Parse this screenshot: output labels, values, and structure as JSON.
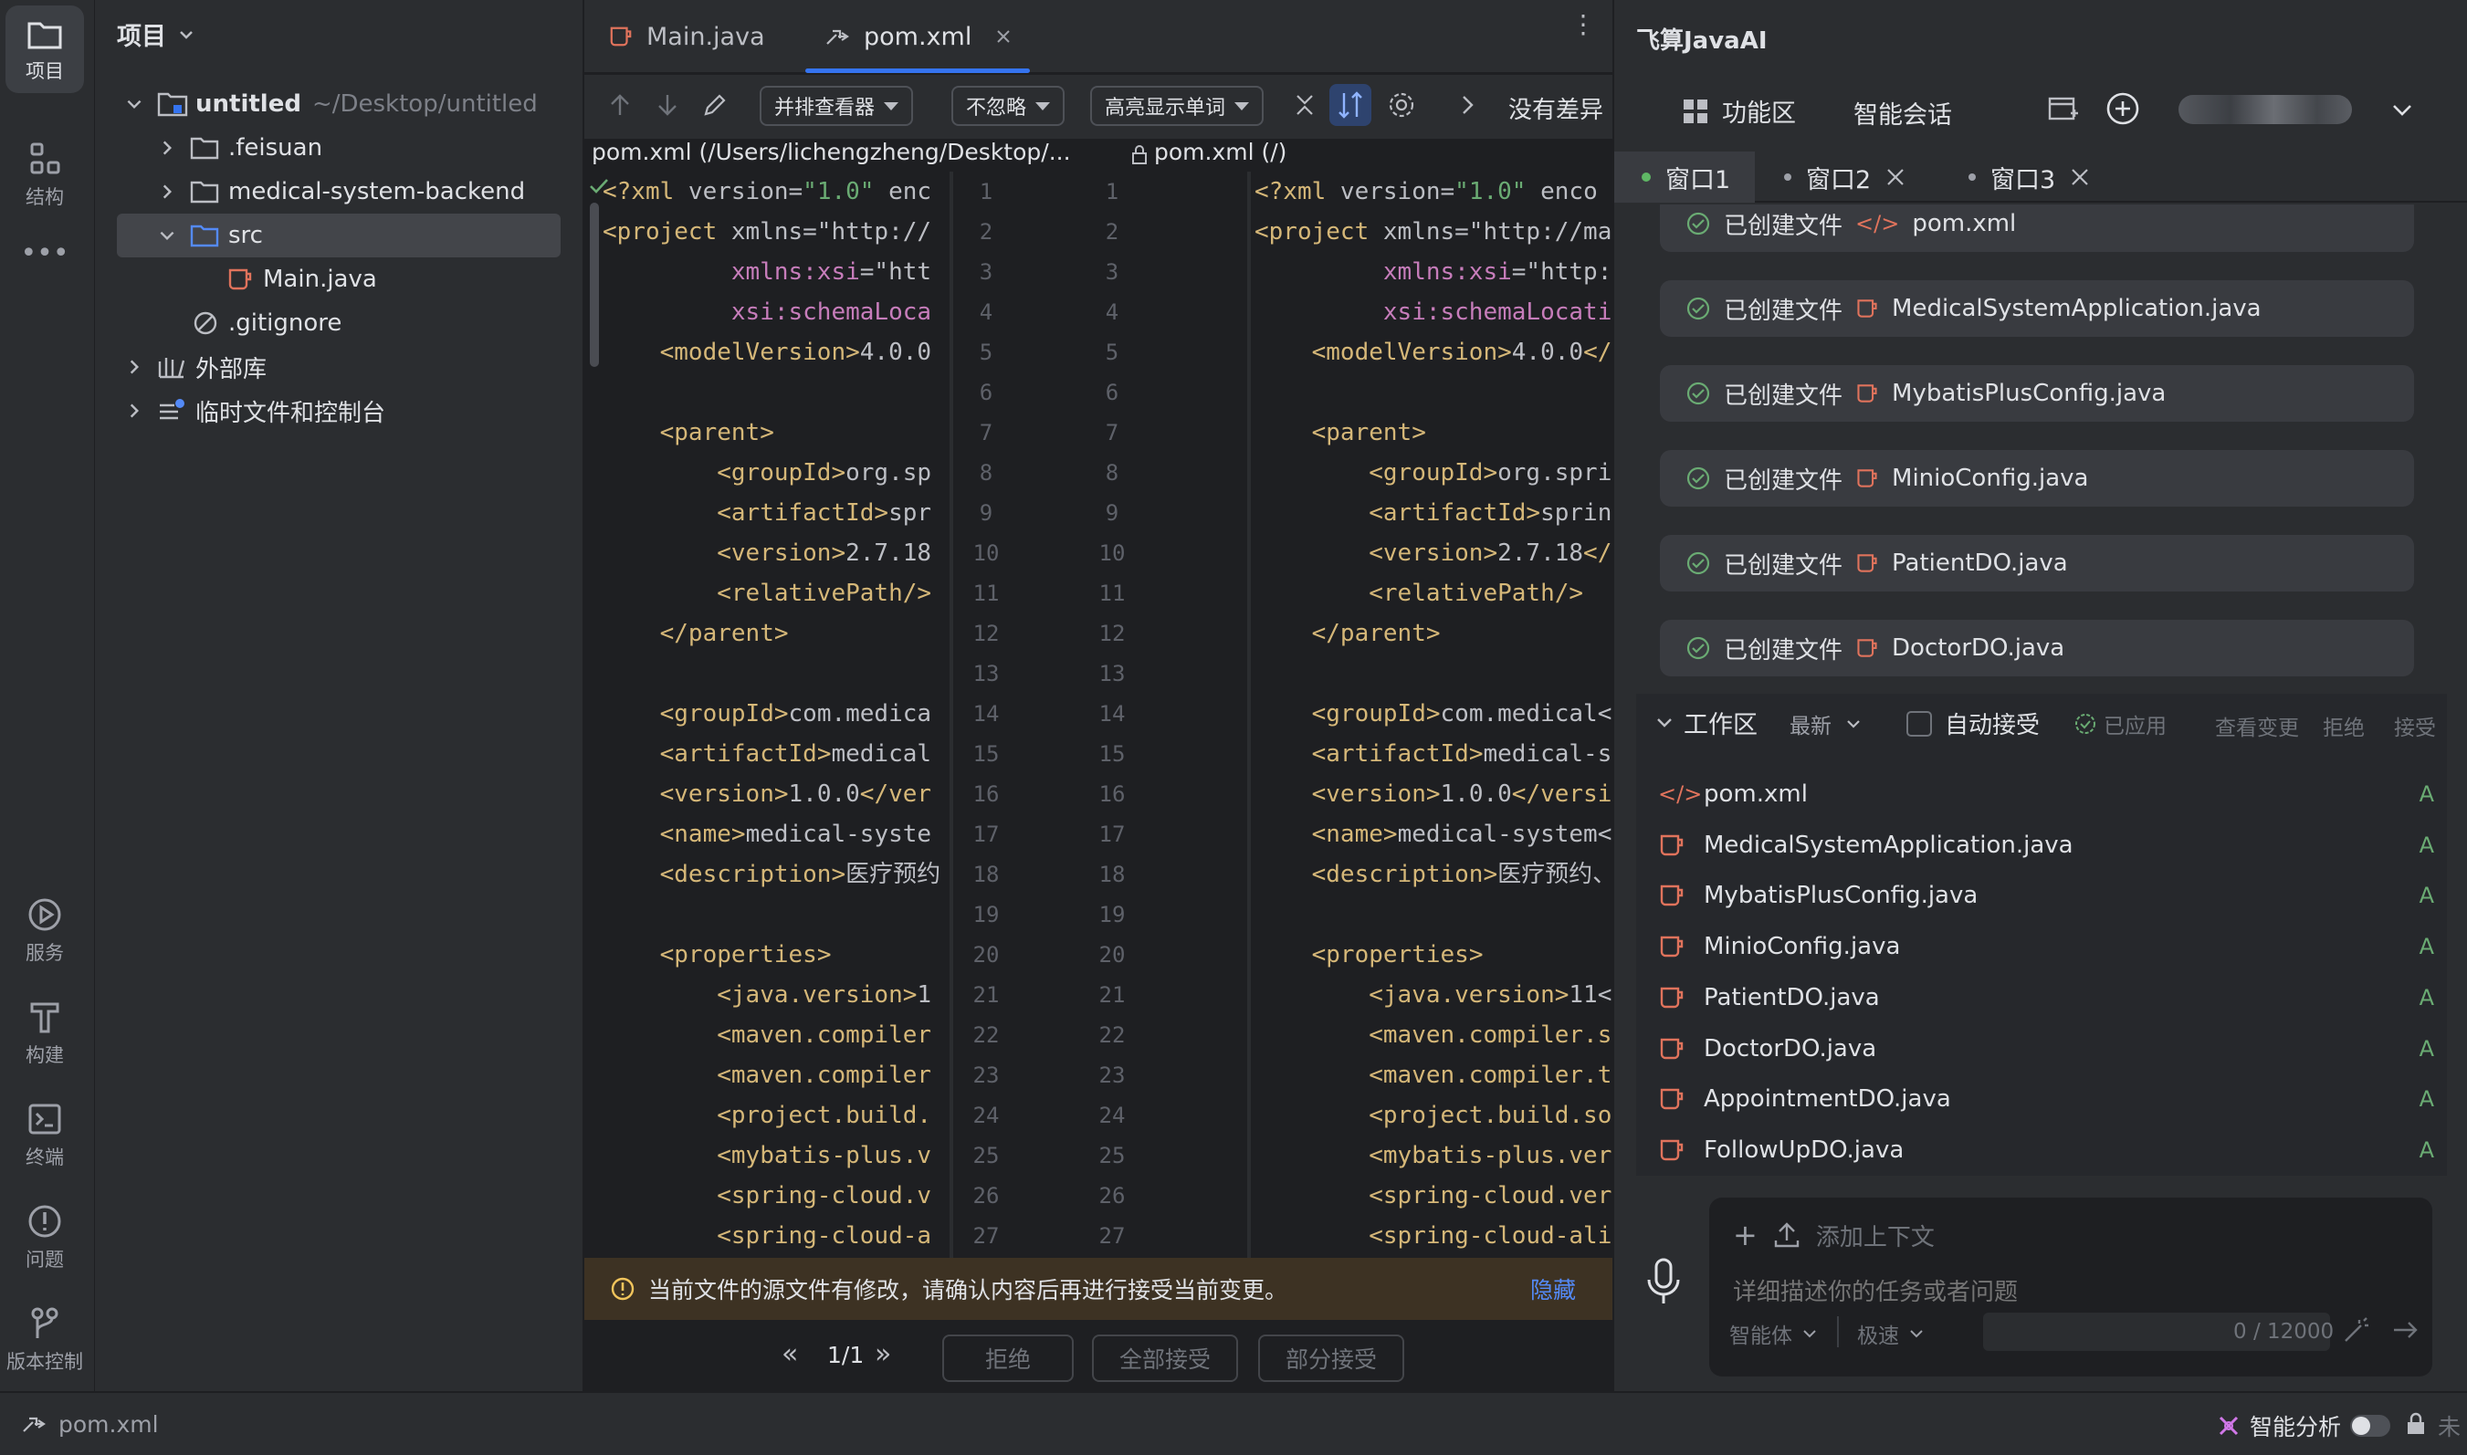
{
  "activity": {
    "items": [
      {
        "label": "项目",
        "icon": "folder-icon"
      },
      {
        "label": "结构",
        "icon": "structure-icon"
      },
      {
        "label": "服务",
        "icon": "services-icon"
      },
      {
        "label": "构建",
        "icon": "build-icon"
      },
      {
        "label": "终端",
        "icon": "terminal-icon"
      },
      {
        "label": "问题",
        "icon": "problems-icon"
      },
      {
        "label": "版本控制",
        "icon": "vcs-icon"
      }
    ]
  },
  "project": {
    "title": "项目",
    "root": {
      "name": "untitled",
      "path": "~/Desktop/untitled"
    },
    "items": [
      {
        "label": ".feisuan"
      },
      {
        "label": "medical-system-backend"
      },
      {
        "label": "src"
      },
      {
        "label": "Main.java"
      },
      {
        "label": ".gitignore"
      },
      {
        "label": "外部库"
      },
      {
        "label": "临时文件和控制台"
      }
    ]
  },
  "editor": {
    "tabs": [
      {
        "label": "Main.java"
      },
      {
        "label": "pom.xml"
      }
    ],
    "toolbar": {
      "viewer": "并排查看器",
      "ignore": "不忽略",
      "highlight": "高亮显示单词",
      "no_diff": "没有差异"
    },
    "left_path": "pom.xml (/Users/lichengzheng/Desktop/...",
    "right_path": "pom.xml (/)",
    "left_lines": [
      "<?xml version=\"1.0\" enc",
      "<project xmlns=\"http://",
      "         xmlns:xsi=\"htt",
      "         xsi:schemaLoca",
      "    <modelVersion>4.0.0",
      "",
      "    <parent>",
      "        <groupId>org.sp",
      "        <artifactId>spr",
      "        <version>2.7.18",
      "        <relativePath/>",
      "    </parent>",
      "",
      "    <groupId>com.medica",
      "    <artifactId>medical",
      "    <version>1.0.0</ver",
      "    <name>medical-syste",
      "    <description>医疗预约",
      "",
      "    <properties>",
      "        <java.version>1",
      "        <maven.compiler",
      "        <maven.compiler",
      "        <project.build.",
      "        <mybatis-plus.v",
      "        <spring-cloud.v",
      "        <spring-cloud-a"
    ],
    "right_lines": [
      "<?xml version=\"1.0\" enco",
      "<project xmlns=\"http://ma",
      "         xmlns:xsi=\"http:",
      "         xsi:schemaLocatic",
      "    <modelVersion>4.0.0</r",
      "",
      "    <parent>",
      "        <groupId>org.sprir",
      "        <artifactId>sprinc",
      "        <version>2.7.18</v",
      "        <relativePath/>",
      "    </parent>",
      "",
      "    <groupId>com.medical<",
      "    <artifactId>medical-sy",
      "    <version>1.0.0</versic",
      "    <name>medical-system<",
      "    <description>医疗预约、",
      "",
      "    <properties>",
      "        <java.version>11<",
      "        <maven.compiler.sc",
      "        <maven.compiler.ta",
      "        <project.build.sou",
      "        <mybatis-plus.vers",
      "        <spring-cloud.vers",
      "        <spring-cloud-alil"
    ],
    "line_numbers": [
      "1",
      "2",
      "3",
      "4",
      "5",
      "6",
      "7",
      "8",
      "9",
      "10",
      "11",
      "12",
      "13",
      "14",
      "15",
      "16",
      "17",
      "18",
      "19",
      "20",
      "21",
      "22",
      "23",
      "24",
      "25",
      "26",
      "27"
    ],
    "notice": "当前文件的源文件有修改，请确认内容后再进行接受当前变更。",
    "notice_hide": "隐藏",
    "pager": "1/1",
    "buttons": {
      "reject": "拒绝",
      "accept_all": "全部接受",
      "accept_part": "部分接受"
    }
  },
  "ai": {
    "title": "飞算JavaAI",
    "tabs": {
      "features": "功能区",
      "chat": "智能会话"
    },
    "windows": [
      {
        "label": "窗口1"
      },
      {
        "label": "窗口2"
      },
      {
        "label": "窗口3"
      }
    ],
    "created_label": "已创建文件",
    "created_files": [
      "pom.xml",
      "MedicalSystemApplication.java",
      "MybatisPlusConfig.java",
      "MinioConfig.java",
      "PatientDO.java",
      "DoctorDO.java"
    ],
    "workspace": {
      "title": "工作区",
      "sort": "最新",
      "auto_accept": "自动接受",
      "applied": "已应用",
      "view_changes": "查看变更",
      "reject": "拒绝",
      "accept": "接受",
      "files": [
        {
          "name": "pom.xml",
          "status": "A"
        },
        {
          "name": "MedicalSystemApplication.java",
          "status": "A"
        },
        {
          "name": "MybatisPlusConfig.java",
          "status": "A"
        },
        {
          "name": "MinioConfig.java",
          "status": "A"
        },
        {
          "name": "PatientDO.java",
          "status": "A"
        },
        {
          "name": "DoctorDO.java",
          "status": "A"
        },
        {
          "name": "AppointmentDO.java",
          "status": "A"
        },
        {
          "name": "FollowUpDO.java",
          "status": "A"
        }
      ]
    },
    "input": {
      "add_context": "添加上下文",
      "placeholder": "详细描述你的任务或者问题",
      "agent": "智能体",
      "speed": "极速",
      "counter": "0 / 12000"
    }
  },
  "status": {
    "file": "pom.xml",
    "smart_analysis": "智能分析",
    "tail": "未"
  },
  "colors": {
    "accent": "#3574f0",
    "success": "#6aab73",
    "tag": "#d5b778",
    "string": "#6aab73"
  }
}
